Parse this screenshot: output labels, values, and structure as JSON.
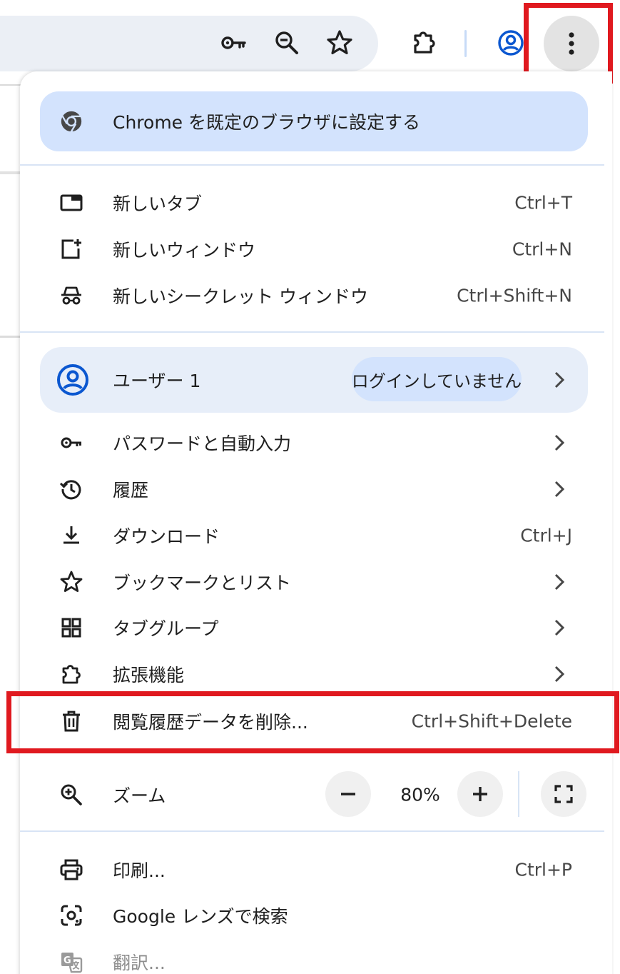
{
  "toolbar": {
    "icons": [
      "key-icon",
      "zoom-out-icon",
      "star-icon",
      "extensions-icon",
      "profile-icon",
      "more-vert-icon"
    ]
  },
  "menu": {
    "set_default": "Chrome を既定のブラウザに設定する",
    "new_tab": {
      "label": "新しいタブ",
      "shortcut": "Ctrl+T"
    },
    "new_window": {
      "label": "新しいウィンドウ",
      "shortcut": "Ctrl+N"
    },
    "incognito": {
      "label": "新しいシークレット ウィンドウ",
      "shortcut": "Ctrl+Shift+N"
    },
    "profile": {
      "name": "ユーザー 1",
      "status": "ログインしていません"
    },
    "passwords": {
      "label": "パスワードと自動入力"
    },
    "history": {
      "label": "履歴"
    },
    "downloads": {
      "label": "ダウンロード",
      "shortcut": "Ctrl+J"
    },
    "bookmarks": {
      "label": "ブックマークとリスト"
    },
    "tab_groups": {
      "label": "タブグループ"
    },
    "extensions": {
      "label": "拡張機能"
    },
    "clear_data": {
      "label": "閲覧履歴データを削除...",
      "shortcut": "Ctrl+Shift+Delete"
    },
    "zoom": {
      "label": "ズーム",
      "level": "80%"
    },
    "print": {
      "label": "印刷...",
      "shortcut": "Ctrl+P"
    },
    "lens": {
      "label": "Google レンズで検索"
    },
    "translate": {
      "label": "翻訳..."
    }
  },
  "colors": {
    "highlight": "#e0191f",
    "accent_blue": "#0b57d0",
    "set_default_bg": "#d3e3fd",
    "profile_bg": "#e7eef9"
  }
}
